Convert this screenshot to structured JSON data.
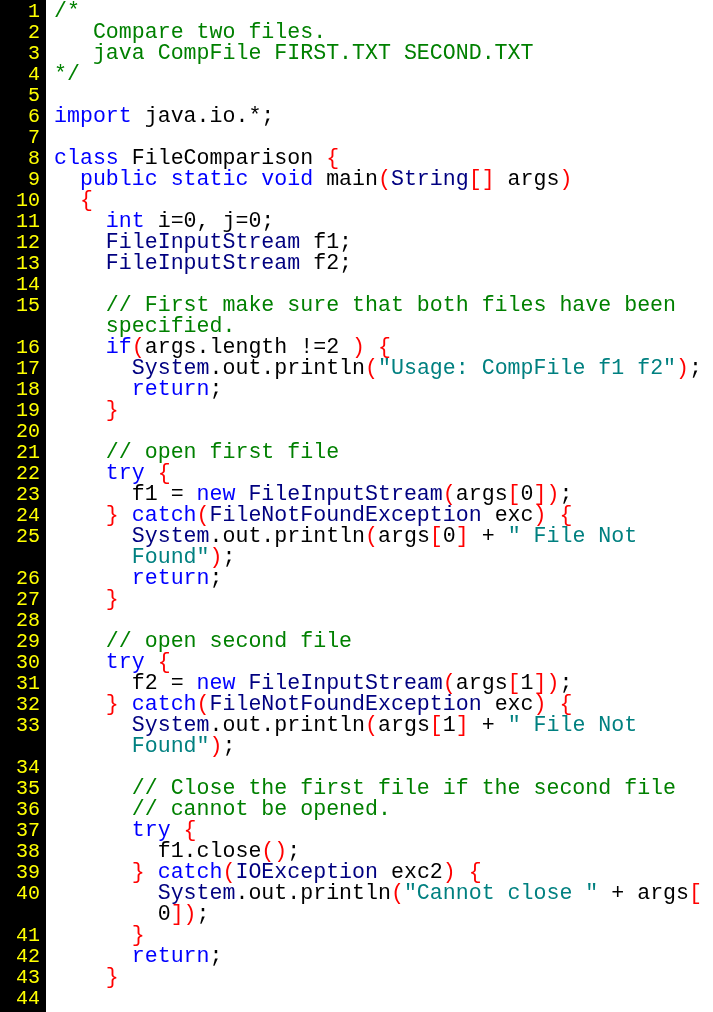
{
  "editor": {
    "lines": [
      {
        "number": "1",
        "wrapped_parts": [
          [
            {
              "kind": "comment",
              "text": "/*"
            }
          ]
        ]
      },
      {
        "number": "2",
        "wrapped_parts": [
          [
            {
              "kind": "comment",
              "text": "   Compare two files."
            }
          ]
        ]
      },
      {
        "number": "3",
        "wrapped_parts": [
          [
            {
              "kind": "comment",
              "text": "   java CompFile FIRST.TXT SECOND.TXT"
            }
          ]
        ]
      },
      {
        "number": "4",
        "wrapped_parts": [
          [
            {
              "kind": "comment",
              "text": "*/"
            }
          ]
        ]
      },
      {
        "number": "5"
      },
      {
        "number": "6",
        "wrapped_parts": [
          [
            {
              "kind": "keyword",
              "text": "import"
            },
            {
              "kind": "plain",
              "text": " java.io.*;"
            }
          ]
        ]
      },
      {
        "number": "7"
      },
      {
        "number": "8",
        "wrapped_parts": [
          [
            {
              "kind": "keyword",
              "text": "class"
            },
            {
              "kind": "plain",
              "text": " FileComparison "
            },
            {
              "kind": "bracket",
              "text": "{"
            }
          ]
        ]
      },
      {
        "number": "9",
        "wrapped_parts": [
          [
            {
              "kind": "keyword",
              "text": "  public"
            },
            {
              "kind": "keyword",
              "text": " static"
            },
            {
              "kind": "keyword",
              "text": " void"
            },
            {
              "kind": "plain",
              "text": " main"
            },
            {
              "kind": "bracket",
              "text": "("
            },
            {
              "kind": "type",
              "text": "String"
            },
            {
              "kind": "bracket",
              "text": "[]"
            },
            {
              "kind": "plain",
              "text": " args"
            },
            {
              "kind": "bracket",
              "text": ")"
            }
          ]
        ]
      },
      {
        "number": "10",
        "wrapped_parts": [
          [
            {
              "kind": "bracket",
              "text": "  {"
            }
          ]
        ]
      },
      {
        "number": "11",
        "wrapped_parts": [
          [
            {
              "kind": "keyword",
              "text": "    int"
            },
            {
              "kind": "plain",
              "text": " i=0, j=0;"
            }
          ]
        ]
      },
      {
        "number": "12",
        "wrapped_parts": [
          [
            {
              "kind": "type",
              "text": "    FileInputStream"
            },
            {
              "kind": "plain",
              "text": " f1;"
            }
          ]
        ]
      },
      {
        "number": "13",
        "wrapped_parts": [
          [
            {
              "kind": "type",
              "text": "    FileInputStream"
            },
            {
              "kind": "plain",
              "text": " f2;"
            }
          ]
        ]
      },
      {
        "number": "14"
      },
      {
        "number": "15",
        "wrapped_parts": [
          [
            {
              "kind": "comment",
              "text": "    // First make sure that both files have been"
            }
          ],
          [
            {
              "kind": "comment",
              "text": "    specified."
            }
          ]
        ]
      },
      {
        "number": "16",
        "wrapped_parts": [
          [
            {
              "kind": "keyword",
              "text": "    if"
            },
            {
              "kind": "bracket",
              "text": "("
            },
            {
              "kind": "plain",
              "text": "args.length !=2 "
            },
            {
              "kind": "bracket",
              "text": ")"
            },
            {
              "kind": "bracket",
              "text": " {"
            }
          ]
        ]
      },
      {
        "number": "17",
        "wrapped_parts": [
          [
            {
              "kind": "type",
              "text": "      System"
            },
            {
              "kind": "plain",
              "text": ".out.println"
            },
            {
              "kind": "bracket",
              "text": "("
            },
            {
              "kind": "string",
              "text": "\"Usage: CompFile f1 f2\""
            },
            {
              "kind": "bracket",
              "text": ")"
            },
            {
              "kind": "plain",
              "text": ";"
            }
          ]
        ]
      },
      {
        "number": "18",
        "wrapped_parts": [
          [
            {
              "kind": "keyword",
              "text": "      return"
            },
            {
              "kind": "plain",
              "text": ";"
            }
          ]
        ]
      },
      {
        "number": "19",
        "wrapped_parts": [
          [
            {
              "kind": "bracket",
              "text": "    }"
            }
          ]
        ]
      },
      {
        "number": "20"
      },
      {
        "number": "21",
        "wrapped_parts": [
          [
            {
              "kind": "comment",
              "text": "    // open first file"
            }
          ]
        ]
      },
      {
        "number": "22",
        "wrapped_parts": [
          [
            {
              "kind": "keyword",
              "text": "    try"
            },
            {
              "kind": "bracket",
              "text": " {"
            }
          ]
        ]
      },
      {
        "number": "23",
        "wrapped_parts": [
          [
            {
              "kind": "plain",
              "text": "      f1 = "
            },
            {
              "kind": "keyword",
              "text": "new"
            },
            {
              "kind": "type",
              "text": " FileInputStream"
            },
            {
              "kind": "bracket",
              "text": "("
            },
            {
              "kind": "plain",
              "text": "args"
            },
            {
              "kind": "bracket",
              "text": "["
            },
            {
              "kind": "plain",
              "text": "0"
            },
            {
              "kind": "bracket",
              "text": "])"
            },
            {
              "kind": "plain",
              "text": ";"
            }
          ]
        ]
      },
      {
        "number": "24",
        "wrapped_parts": [
          [
            {
              "kind": "bracket",
              "text": "    }"
            },
            {
              "kind": "keyword",
              "text": " catch"
            },
            {
              "kind": "bracket",
              "text": "("
            },
            {
              "kind": "type",
              "text": "FileNotFoundException"
            },
            {
              "kind": "plain",
              "text": " exc"
            },
            {
              "kind": "bracket",
              "text": ")"
            },
            {
              "kind": "bracket",
              "text": " {"
            }
          ]
        ]
      },
      {
        "number": "25",
        "wrapped_parts": [
          [
            {
              "kind": "type",
              "text": "      System"
            },
            {
              "kind": "plain",
              "text": ".out.println"
            },
            {
              "kind": "bracket",
              "text": "("
            },
            {
              "kind": "plain",
              "text": "args"
            },
            {
              "kind": "bracket",
              "text": "["
            },
            {
              "kind": "plain",
              "text": "0"
            },
            {
              "kind": "bracket",
              "text": "]"
            },
            {
              "kind": "plain",
              "text": " + "
            },
            {
              "kind": "string",
              "text": "\" File Not"
            }
          ],
          [
            {
              "kind": "string",
              "text": "      Found\""
            },
            {
              "kind": "bracket",
              "text": ")"
            },
            {
              "kind": "plain",
              "text": ";"
            }
          ]
        ]
      },
      {
        "number": "26",
        "wrapped_parts": [
          [
            {
              "kind": "keyword",
              "text": "      return"
            },
            {
              "kind": "plain",
              "text": ";"
            }
          ]
        ]
      },
      {
        "number": "27",
        "wrapped_parts": [
          [
            {
              "kind": "bracket",
              "text": "    }"
            }
          ]
        ]
      },
      {
        "number": "28"
      },
      {
        "number": "29",
        "wrapped_parts": [
          [
            {
              "kind": "comment",
              "text": "    // open second file"
            }
          ]
        ]
      },
      {
        "number": "30",
        "wrapped_parts": [
          [
            {
              "kind": "keyword",
              "text": "    try"
            },
            {
              "kind": "bracket",
              "text": " {"
            }
          ]
        ]
      },
      {
        "number": "31",
        "wrapped_parts": [
          [
            {
              "kind": "plain",
              "text": "      f2 = "
            },
            {
              "kind": "keyword",
              "text": "new"
            },
            {
              "kind": "type",
              "text": " FileInputStream"
            },
            {
              "kind": "bracket",
              "text": "("
            },
            {
              "kind": "plain",
              "text": "args"
            },
            {
              "kind": "bracket",
              "text": "["
            },
            {
              "kind": "plain",
              "text": "1"
            },
            {
              "kind": "bracket",
              "text": "])"
            },
            {
              "kind": "plain",
              "text": ";"
            }
          ]
        ]
      },
      {
        "number": "32",
        "wrapped_parts": [
          [
            {
              "kind": "bracket",
              "text": "    }"
            },
            {
              "kind": "keyword",
              "text": " catch"
            },
            {
              "kind": "bracket",
              "text": "("
            },
            {
              "kind": "type",
              "text": "FileNotFoundException"
            },
            {
              "kind": "plain",
              "text": " exc"
            },
            {
              "kind": "bracket",
              "text": ")"
            },
            {
              "kind": "bracket",
              "text": " {"
            }
          ]
        ]
      },
      {
        "number": "33",
        "wrapped_parts": [
          [
            {
              "kind": "type",
              "text": "      System"
            },
            {
              "kind": "plain",
              "text": ".out.println"
            },
            {
              "kind": "bracket",
              "text": "("
            },
            {
              "kind": "plain",
              "text": "args"
            },
            {
              "kind": "bracket",
              "text": "["
            },
            {
              "kind": "plain",
              "text": "1"
            },
            {
              "kind": "bracket",
              "text": "]"
            },
            {
              "kind": "plain",
              "text": " + "
            },
            {
              "kind": "string",
              "text": "\" File Not"
            }
          ],
          [
            {
              "kind": "string",
              "text": "      Found\""
            },
            {
              "kind": "bracket",
              "text": ")"
            },
            {
              "kind": "plain",
              "text": ";"
            }
          ]
        ]
      },
      {
        "number": "34"
      },
      {
        "number": "35",
        "wrapped_parts": [
          [
            {
              "kind": "comment",
              "text": "      // Close the first file if the second file"
            }
          ]
        ]
      },
      {
        "number": "36",
        "wrapped_parts": [
          [
            {
              "kind": "comment",
              "text": "      // cannot be opened."
            }
          ]
        ]
      },
      {
        "number": "37",
        "wrapped_parts": [
          [
            {
              "kind": "keyword",
              "text": "      try"
            },
            {
              "kind": "bracket",
              "text": " {"
            }
          ]
        ]
      },
      {
        "number": "38",
        "wrapped_parts": [
          [
            {
              "kind": "plain",
              "text": "        f1.close"
            },
            {
              "kind": "bracket",
              "text": "()"
            },
            {
              "kind": "plain",
              "text": ";"
            }
          ]
        ]
      },
      {
        "number": "39",
        "wrapped_parts": [
          [
            {
              "kind": "bracket",
              "text": "      }"
            },
            {
              "kind": "keyword",
              "text": " catch"
            },
            {
              "kind": "bracket",
              "text": "("
            },
            {
              "kind": "type",
              "text": "IOException"
            },
            {
              "kind": "plain",
              "text": " exc2"
            },
            {
              "kind": "bracket",
              "text": ")"
            },
            {
              "kind": "bracket",
              "text": " {"
            }
          ]
        ]
      },
      {
        "number": "40",
        "wrapped_parts": [
          [
            {
              "kind": "type",
              "text": "        System"
            },
            {
              "kind": "plain",
              "text": ".out.println"
            },
            {
              "kind": "bracket",
              "text": "("
            },
            {
              "kind": "string",
              "text": "\"Cannot close \""
            },
            {
              "kind": "plain",
              "text": " + args"
            },
            {
              "kind": "bracket",
              "text": "["
            }
          ],
          [
            {
              "kind": "plain",
              "text": "        0"
            },
            {
              "kind": "bracket",
              "text": "])"
            },
            {
              "kind": "plain",
              "text": ";"
            }
          ]
        ]
      },
      {
        "number": "41",
        "wrapped_parts": [
          [
            {
              "kind": "bracket",
              "text": "      }"
            }
          ]
        ]
      },
      {
        "number": "42",
        "wrapped_parts": [
          [
            {
              "kind": "keyword",
              "text": "      return"
            },
            {
              "kind": "plain",
              "text": ";"
            }
          ]
        ]
      },
      {
        "number": "43",
        "wrapped_parts": [
          [
            {
              "kind": "bracket",
              "text": "    }"
            }
          ]
        ]
      },
      {
        "number": "44"
      }
    ]
  }
}
